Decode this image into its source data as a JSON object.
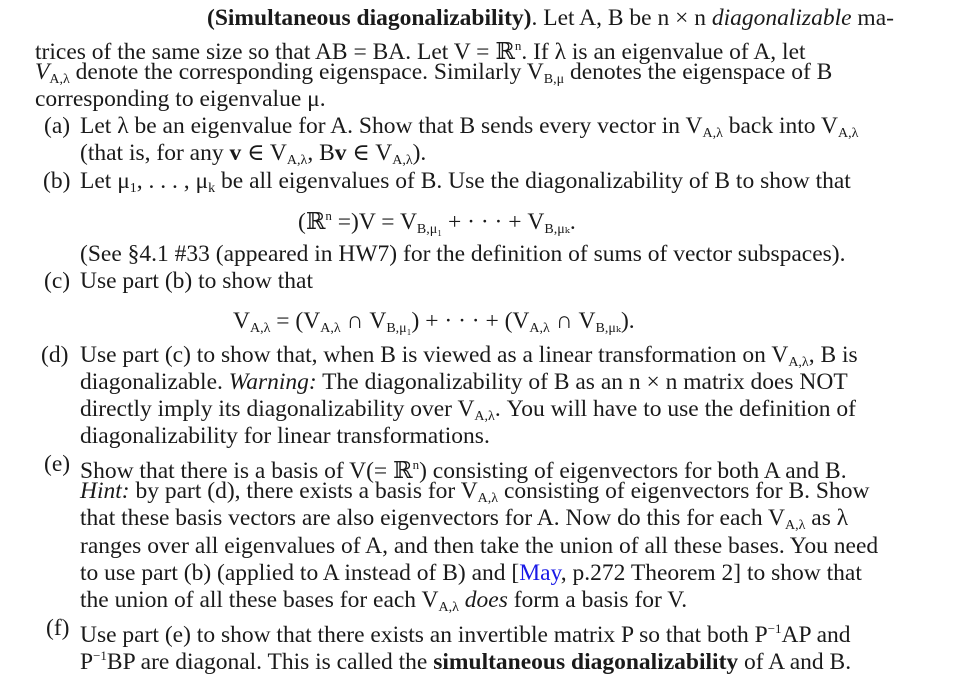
{
  "problem": {
    "title": "(Simultaneous diagonalizability)",
    "intro_lines": [
      ". Let A, B be n × n ",
      "diagonalizable",
      " ma-",
      "trices of the same size so that AB = BA.  Let V = ℝ",
      "n",
      ".  If λ is an eigenvalue of A, let",
      "V",
      "A,λ",
      " denote the corresponding eigenspace.  Similarly V",
      "B,μ",
      " denotes the eigenspace of B",
      "corresponding to eigenvalue μ."
    ],
    "parts": {
      "a": {
        "label": "(a)",
        "line1_pre": "Let λ be an eigenvalue for A. Show that B sends every vector in V",
        "line1_mid": " back into V",
        "line2": "(that is, for any ",
        "line2_v": "v",
        "line2_in": " ∈ V",
        "line2_b": ", B",
        "line2_end": ")."
      },
      "b": {
        "label": "(b)",
        "line1": "Let μ",
        "line1_mid": ", . . . , μ",
        "line1_end": " be all eigenvalues of B. Use the diagonalizability of B to show that",
        "eq_pre": "(ℝ",
        "eq_mid": " =)V = V",
        "eq_plus": " + · · · + V",
        "eq_end": ".",
        "note": "(See §4.1 #33 (appeared in HW7) for the definition of sums of vector subspaces)."
      },
      "c": {
        "label": "(c)",
        "line1": "Use part (b) to show that",
        "eq1": "V",
        "eq2": " = (V",
        "eq3": " ∩ V",
        "eq4": ") + · · · + (V",
        "eq5": " ∩ V",
        "eq6": ")."
      },
      "d": {
        "label": "(d)",
        "line1": "Use part (c) to show that, when B is viewed as a linear transformation on V",
        "line1_end": ", B is",
        "line2_pre": "diagonalizable. ",
        "line2_warn": "Warning:",
        "line2_rest": " The diagonalizability of B as an n × n matrix does NOT",
        "line3": "directly imply its diagonalizability over V",
        "line3_end": ". You will have to use the definition of",
        "line4": "diagonalizability for linear transformations."
      },
      "e": {
        "label": "(e)",
        "line1_pre": "Show that there is a basis of V(= ℝ",
        "line1_end": ") consisting of eigenvectors for both A and B.",
        "line2_hint": "Hint:",
        "line2": " by part (d), there exists a basis for V",
        "line2_end": " consisting of eigenvectors for B. Show",
        "line3": "that these basis vectors are also eigenvectors for A.  Now do this for each V",
        "line3_end": " as λ",
        "line4": "ranges over all eigenvalues of A, and then take the union of all these bases.  You need",
        "line5_pre": "to use part (b) (applied to A instead of B) and [",
        "line5_link": "May",
        "line5_end": ", p.272 Theorem 2] to show that",
        "line6_pre": "the union of all these bases for each V",
        "line6_does": "does",
        "line6_end": " form a basis for V."
      },
      "f": {
        "label": "(f)",
        "line1": "Use part (e) to show that there exists an invertible matrix P so that both P",
        "line1_end": "AP and",
        "line2_pre": "P",
        "line2_mid": "BP are diagonal. This is called the ",
        "line2_bold": "simultaneous diagonalizability",
        "line2_end": " of A and B."
      }
    },
    "symbols": {
      "sub_A_lambda": "A,λ",
      "sub_B_mu": "B,μ",
      "sub_B_mu1": "B,μ₁",
      "sub_B_muk": "B,μₖ",
      "sub_1": "1",
      "sub_k": "k",
      "sup_n": "n",
      "sup_inv": "−1"
    },
    "colors": {
      "text": "#1a1a1a",
      "link": "#1a1ae6"
    }
  }
}
